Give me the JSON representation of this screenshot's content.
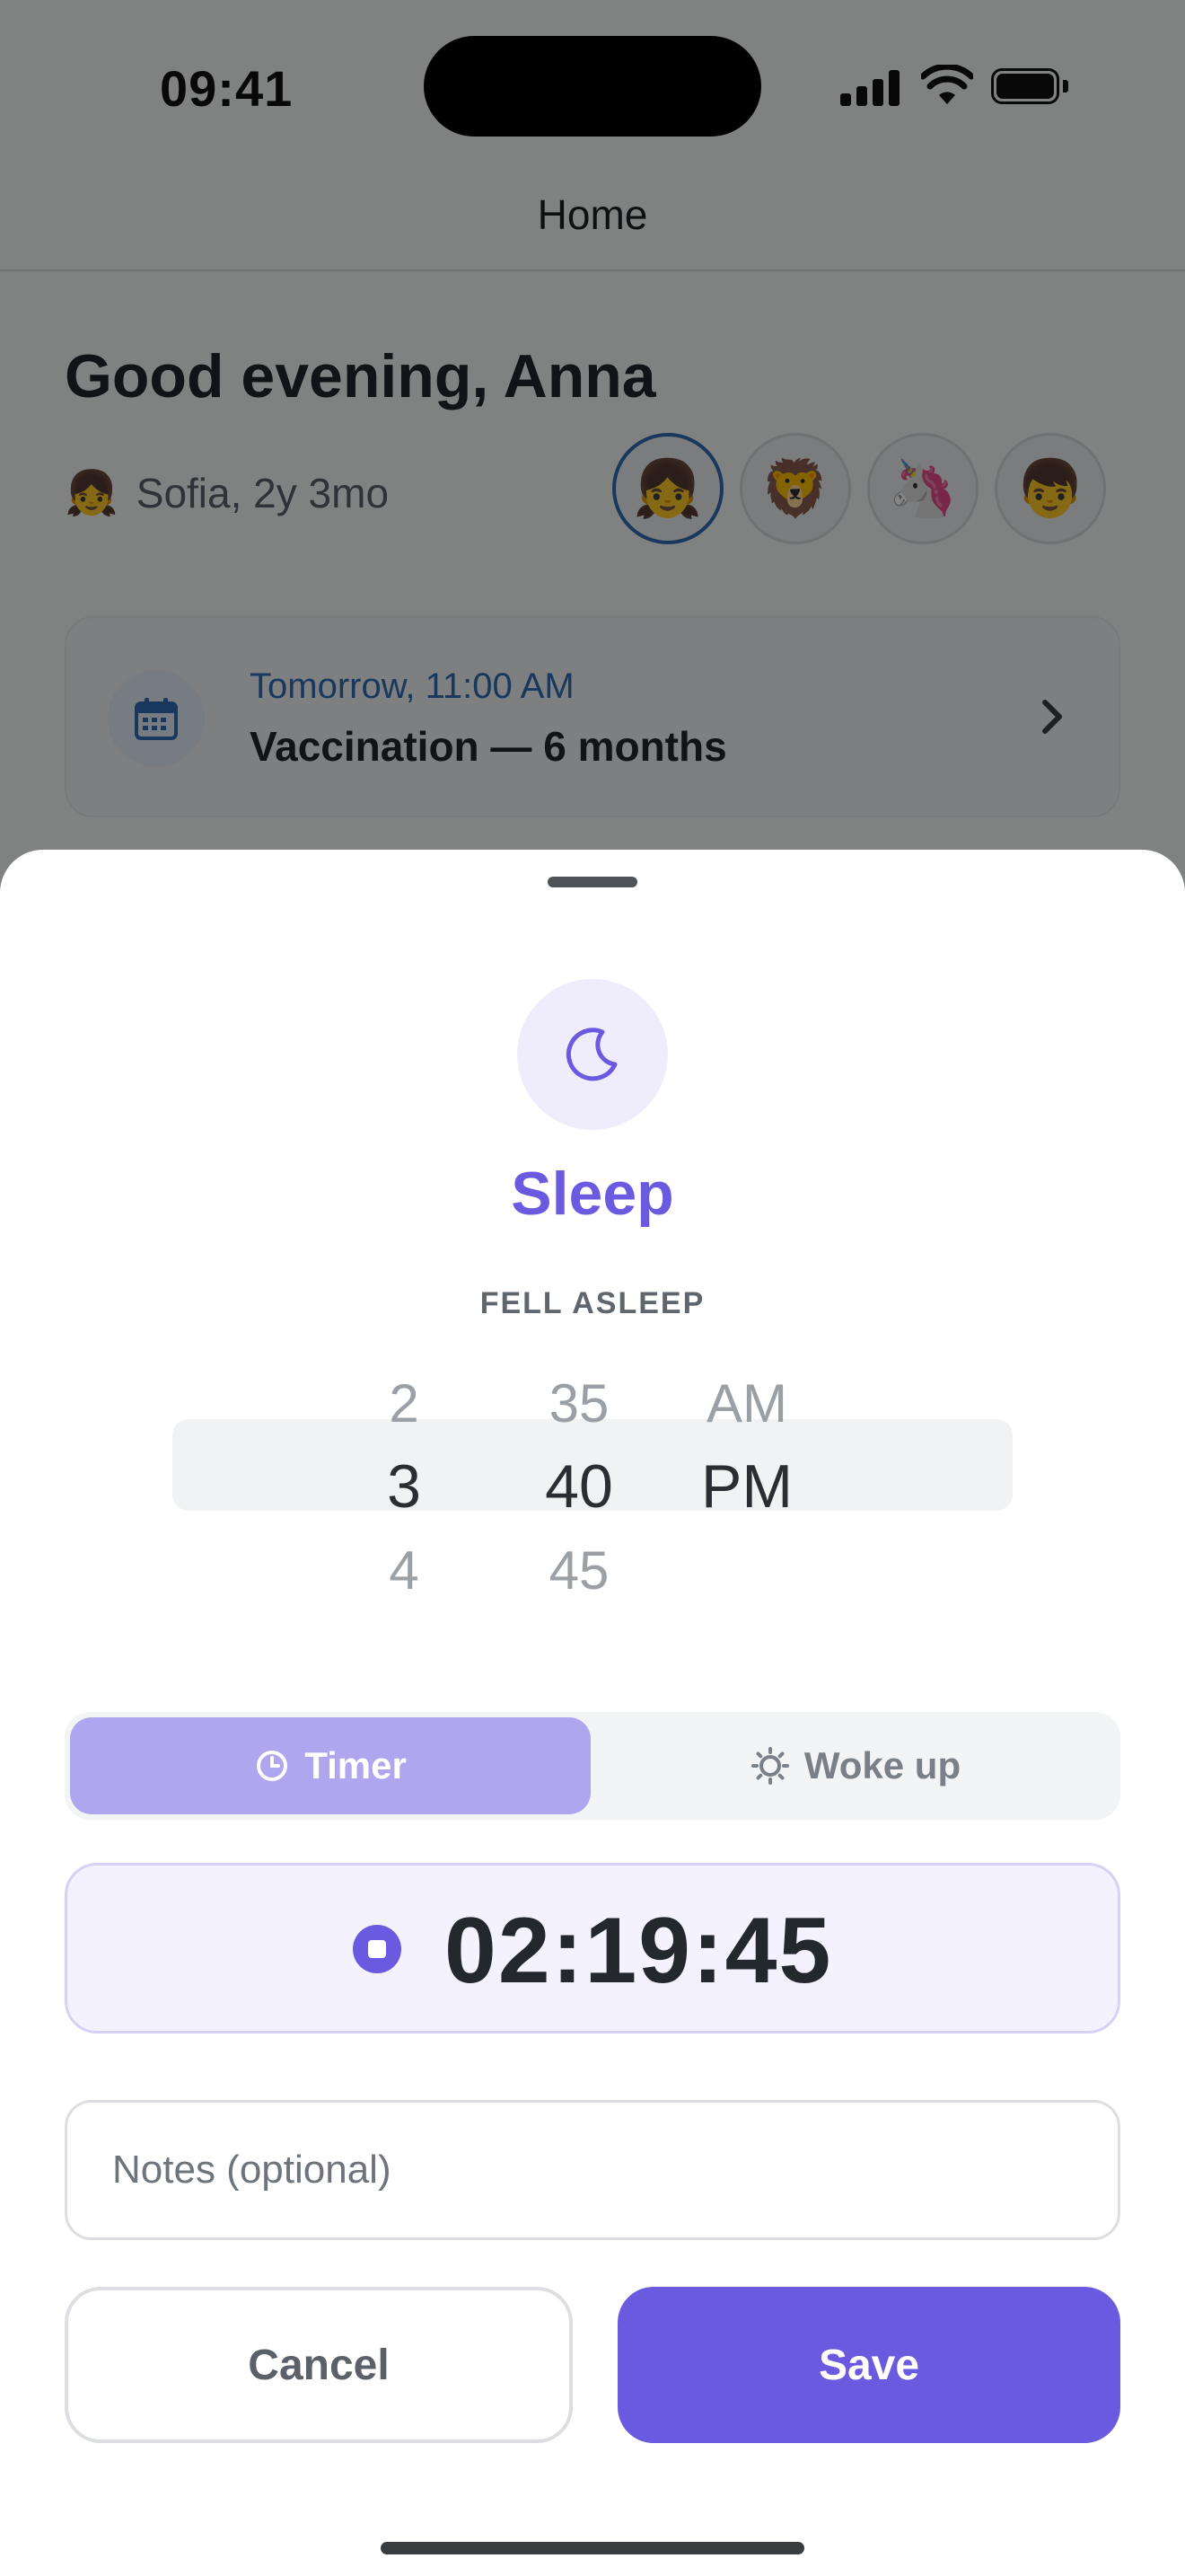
{
  "status_bar": {
    "time": "09:41"
  },
  "nav": {
    "title": "Home"
  },
  "home": {
    "greeting": "Good evening, Anna",
    "child": {
      "emoji": "👧",
      "label": "Sofia, 2y 3mo"
    },
    "avatars": [
      {
        "emoji": "👧",
        "active": true
      },
      {
        "emoji": "🦁",
        "active": false
      },
      {
        "emoji": "🦄",
        "active": false
      },
      {
        "emoji": "👦",
        "active": false
      }
    ],
    "event": {
      "date": "Tomorrow, 11:00 AM",
      "title": "Vaccination — 6 months",
      "icon": "calendar-icon"
    }
  },
  "sheet": {
    "icon": "moon-icon",
    "title": "Sleep",
    "section_label": "FELL ASLEEP",
    "picker": {
      "hours": [
        "2",
        "3",
        "4"
      ],
      "minutes": [
        "35",
        "40",
        "45"
      ],
      "period": [
        "AM",
        "PM",
        ""
      ],
      "selected": {
        "hour": "3",
        "minute": "40",
        "period": "PM"
      }
    },
    "segments": {
      "timer": {
        "label": "Timer",
        "icon": "clock-icon",
        "active": true
      },
      "woke_up": {
        "label": "Woke up",
        "icon": "sun-icon",
        "active": false
      }
    },
    "timer": {
      "value": "02:19:45",
      "stop_icon": "stop-icon"
    },
    "notes": {
      "placeholder": "Notes (optional)",
      "value": ""
    },
    "buttons": {
      "cancel": "Cancel",
      "save": "Save"
    }
  },
  "colors": {
    "accent": "#6a5ae0",
    "accent_light": "#aea6ee",
    "link_blue": "#2f6cb3"
  }
}
